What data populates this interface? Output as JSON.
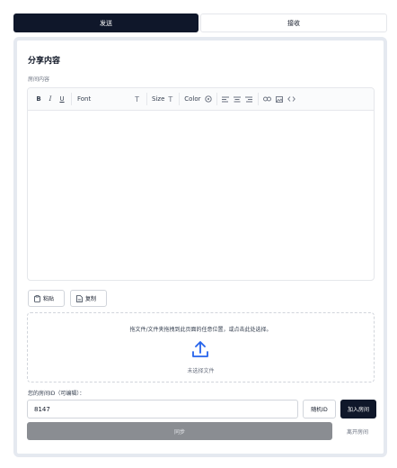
{
  "tabs": [
    {
      "label": "发送",
      "active": true
    },
    {
      "label": "接收",
      "active": false
    }
  ],
  "card": {
    "title": "分享内容",
    "room_content_label": "房间内容"
  },
  "toolbar": {
    "bold": "B",
    "italic": "I",
    "underline": "U",
    "font_label": "Font",
    "size_label": "Size",
    "color_label": "Color"
  },
  "buttons": {
    "paste": "粘贴",
    "copy": "复制"
  },
  "dropzone": {
    "instruction": "拖文件/文件夹拖拽到此页面的任意位置，或点击此处选择。",
    "status": "未选择文件"
  },
  "room": {
    "id_label": "您的房间ID（可编辑）：",
    "id_value": "8147",
    "random_button": "随机ID",
    "join_button": "加入房间"
  },
  "actions": {
    "sync": "同步",
    "leave": "离开房间"
  },
  "colors": {
    "primary": "#0f172a",
    "disabled": "#8a8d92",
    "border": "#e5e7eb"
  }
}
